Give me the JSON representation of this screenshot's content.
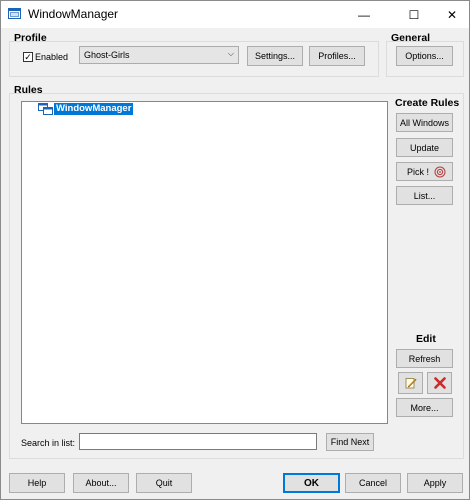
{
  "window": {
    "title": "WindowManager",
    "minimize_glyph": "—",
    "maximize_glyph": "☐",
    "close_glyph": "✕"
  },
  "profile": {
    "label": "Profile",
    "enabled_label": "Enabled",
    "enabled_checked": true,
    "checkmark": "✓",
    "selected_profile": "Ghost-Girls",
    "settings_button": "Settings...",
    "profiles_button": "Profiles..."
  },
  "general": {
    "label": "General",
    "options_button": "Options..."
  },
  "rules": {
    "label": "Rules",
    "tree_root": "WindowManager"
  },
  "create_rules": {
    "label": "Create Rules",
    "all_windows_button": "All Windows",
    "update_button": "Update",
    "pick_button": "Pick !",
    "list_button": "List..."
  },
  "edit": {
    "label": "Edit",
    "refresh_button": "Refresh",
    "more_button": "More..."
  },
  "search": {
    "label": "Search in list:",
    "value": "",
    "find_next_button": "Find Next"
  },
  "footer": {
    "help_button": "Help",
    "about_button": "About...",
    "quit_button": "Quit",
    "ok_button": "OK",
    "cancel_button": "Cancel",
    "apply_button": "Apply"
  },
  "colors": {
    "accent": "#0078d7",
    "delete": "#cc2b2b"
  }
}
